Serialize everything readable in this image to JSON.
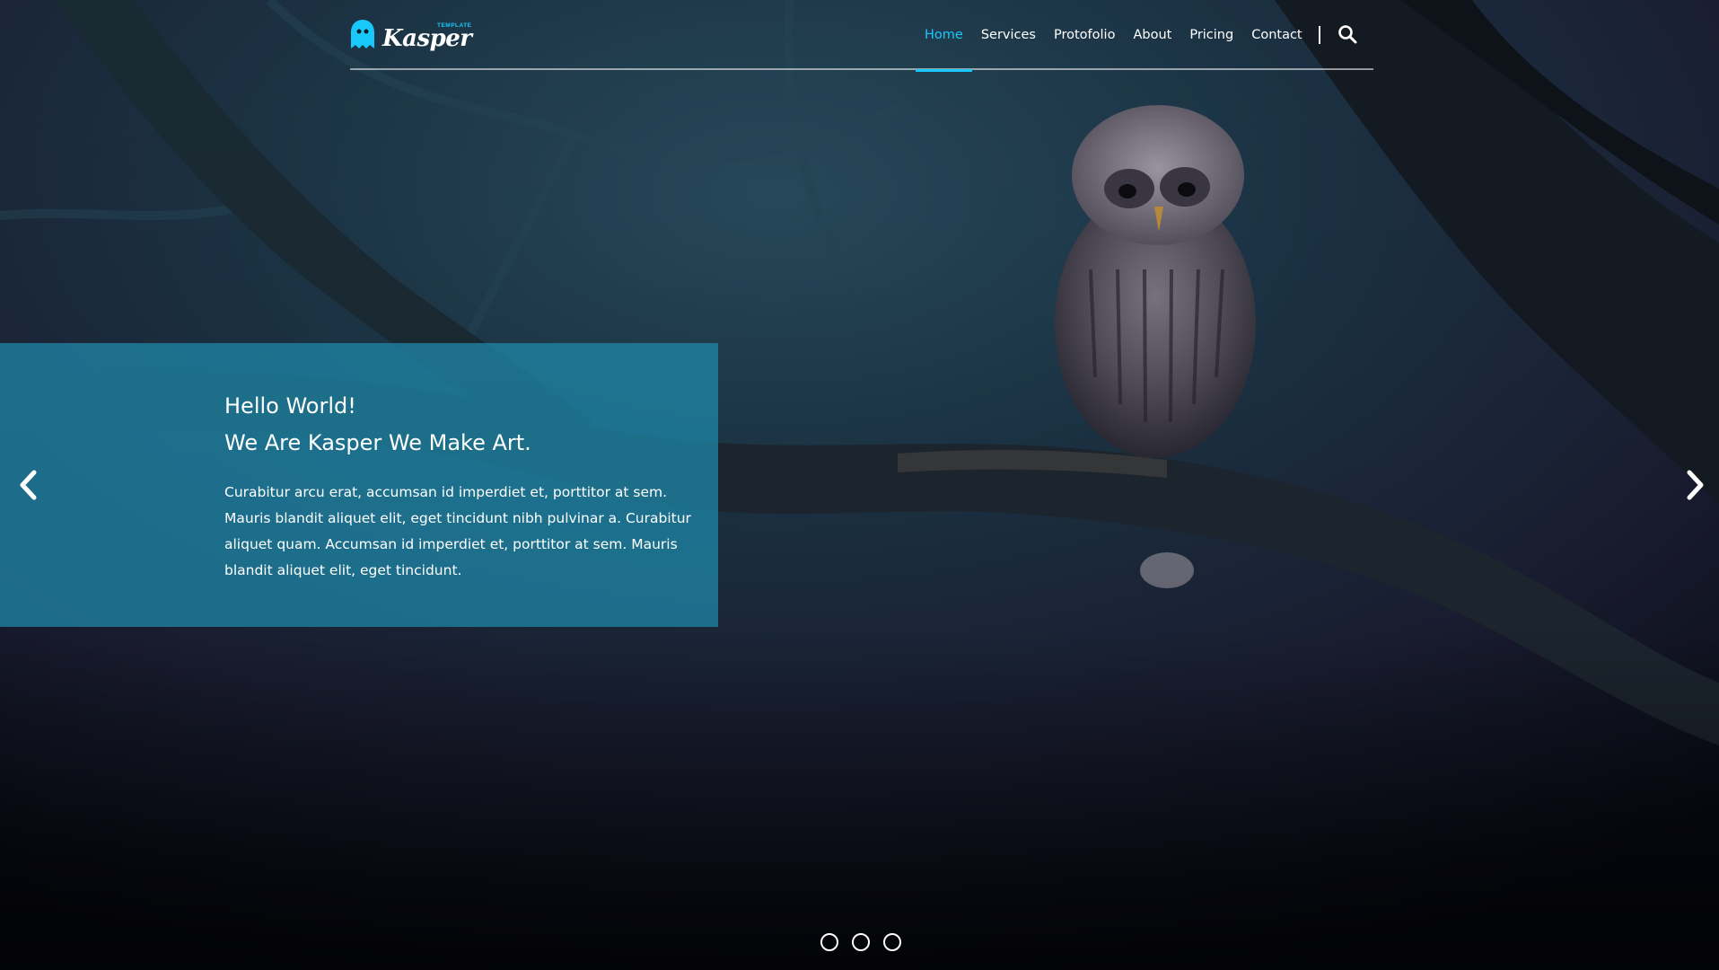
{
  "brand": {
    "name": "Kasper",
    "tagline": "TEMPLATE",
    "logo_icon": "ghost-icon",
    "accent_color": "#19c8fa"
  },
  "nav": {
    "items": [
      {
        "label": "Home",
        "active": true
      },
      {
        "label": "Services",
        "active": false
      },
      {
        "label": "Protofolio",
        "active": false
      },
      {
        "label": "About",
        "active": false
      },
      {
        "label": "Pricing",
        "active": false
      },
      {
        "label": "Contact",
        "active": false
      }
    ],
    "search_icon": "search-icon"
  },
  "slide": {
    "title_line1": "Hello World!",
    "title_line2": "We Are Kasper We Make Art.",
    "text": "Curabitur arcu erat, accumsan id imperdiet et, porttitor at sem. Mauris blandit aliquet elit, eget tincidunt nibh pulvinar a. Curabitur aliquet quam. Accumsan id imperdiet et, porttitor at sem. Mauris blandit aliquet elit, eget tincidunt.",
    "panel_color": "#1f8aac"
  },
  "carousel": {
    "prev_icon": "chevron-left-icon",
    "next_icon": "chevron-right-icon",
    "slide_count": 3
  }
}
